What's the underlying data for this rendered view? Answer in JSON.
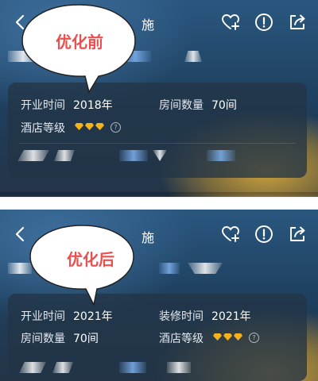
{
  "before": {
    "label": "优化前",
    "title_fragment": "施",
    "info": {
      "opening_time_label": "开业时间",
      "opening_time_value": "2018年",
      "rooms_label": "房间数量",
      "rooms_value": "70间",
      "grade_label": "酒店等级",
      "grade_diamonds": 3,
      "help_icon": "?"
    }
  },
  "after": {
    "label": "优化后",
    "title_fragment": "施",
    "info": {
      "opening_time_label": "开业时间",
      "opening_time_value": "2021年",
      "renovation_label": "装修时间",
      "renovation_value": "2021年",
      "rooms_label": "房间数量",
      "rooms_value": "70间",
      "grade_label": "酒店等级",
      "grade_diamonds": 3,
      "help_icon": "?"
    }
  },
  "icons": [
    "back-arrow-icon",
    "heart-plus-icon",
    "info-icon",
    "share-icon",
    "diamond-icon",
    "help-icon"
  ],
  "colors": {
    "label_red": "#ec4f4f",
    "diamond_gold": "#f5b21a",
    "card_bg": "#223446"
  }
}
